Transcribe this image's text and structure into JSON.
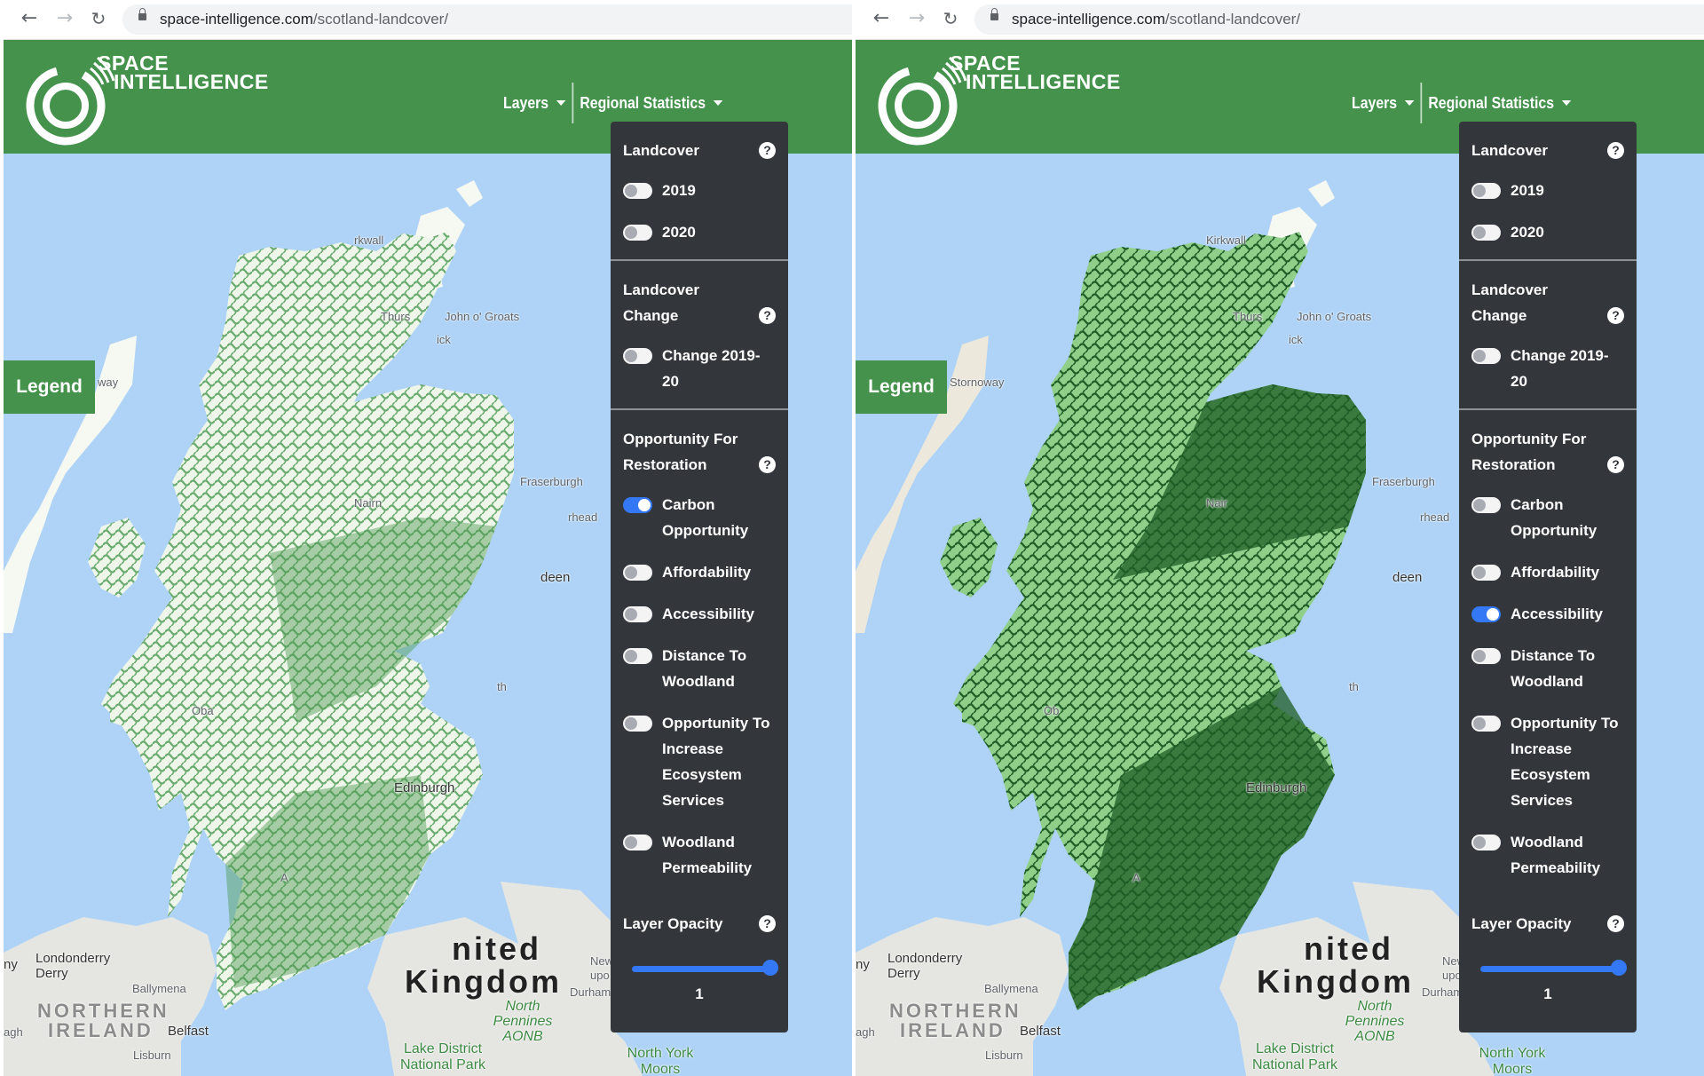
{
  "browser": {
    "url_host": "space-intelligence.com",
    "url_path": "/scotland-landcover/",
    "icons": {
      "back": "arrow-left-icon",
      "forward": "arrow-right-icon",
      "reload": "reload-icon",
      "lock": "lock-icon"
    }
  },
  "colors": {
    "header_green": "#44924c",
    "panel_bg": "#33363b",
    "toggle_on": "#3478f6",
    "sea": "#aed3f7",
    "layer_dark_green": "#1f5e26"
  },
  "panes": [
    {
      "brand": {
        "line1": "SPACE",
        "line2": "INTELLIGENCE"
      },
      "menu": {
        "layers": "Layers",
        "regional_statistics": "Regional Statistics"
      },
      "legend_label": "Legend",
      "sections": [
        {
          "title": "Landcover",
          "toggles": [
            {
              "label": "2019",
              "on": false
            },
            {
              "label": "2020",
              "on": false
            }
          ]
        },
        {
          "title": "Landcover Change",
          "toggles": [
            {
              "label": "Change 2019-20",
              "on": false
            }
          ]
        },
        {
          "title": "Opportunity For Restoration",
          "toggles": [
            {
              "label": "Carbon Opportunity",
              "on": true
            },
            {
              "label": "Affordability",
              "on": false
            },
            {
              "label": "Accessibility",
              "on": false
            },
            {
              "label": "Distance To Woodland",
              "on": false
            },
            {
              "label": "Opportunity To Increase Ecosystem Services",
              "on": false
            },
            {
              "label": "Woodland Permeability",
              "on": false
            }
          ]
        }
      ],
      "opacity": {
        "title": "Layer Opacity",
        "value": "1",
        "fraction": 1
      },
      "active_layer": "Carbon Opportunity",
      "map_labels": {
        "kirkwall": "rkwall",
        "thurso": "Thurs",
        "john_o_groats": "John o' Groats",
        "wick": "ick",
        "stornoway": "way",
        "fraserburgh": "Fraserburgh",
        "nairn": "Nairn",
        "peterhead": "rhead",
        "aberdeen": "deen",
        "montrose": "th",
        "oban": "Oba",
        "edinburgh": "Edinburgh",
        "united": "nited",
        "kingdom": "Kingdom",
        "londonderry": "Londonderry",
        "derry": "Derry",
        "ballymena": "Ballymena",
        "northern": "NORTHERN",
        "ireland": "IRELAND",
        "omagh": "agh",
        "belfast": "Belfast",
        "lisburn": "Lisburn",
        "newcastle": "New",
        "upon": "upo",
        "durham": "Durham",
        "north_pennines": "North Pennines AONB",
        "lake_district": "Lake District National Park",
        "north_york_moors": "North York Moors",
        "ayr": "A",
        "ny": "ny"
      }
    },
    {
      "brand": {
        "line1": "SPACE",
        "line2": "INTELLIGENCE"
      },
      "menu": {
        "layers": "Layers",
        "regional_statistics": "Regional Statistics"
      },
      "legend_label": "Legend",
      "sections": [
        {
          "title": "Landcover",
          "toggles": [
            {
              "label": "2019",
              "on": false
            },
            {
              "label": "2020",
              "on": false
            }
          ]
        },
        {
          "title": "Landcover Change",
          "toggles": [
            {
              "label": "Change 2019-20",
              "on": false
            }
          ]
        },
        {
          "title": "Opportunity For Restoration",
          "toggles": [
            {
              "label": "Carbon Opportunity",
              "on": false
            },
            {
              "label": "Affordability",
              "on": false
            },
            {
              "label": "Accessibility",
              "on": true
            },
            {
              "label": "Distance To Woodland",
              "on": false
            },
            {
              "label": "Opportunity To Increase Ecosystem Services",
              "on": false
            },
            {
              "label": "Woodland Permeability",
              "on": false
            }
          ]
        }
      ],
      "opacity": {
        "title": "Layer Opacity",
        "value": "1",
        "fraction": 1
      },
      "active_layer": "Accessibility",
      "map_labels": {
        "kirkwall": "Kirkwall",
        "thurso": "Thurs",
        "john_o_groats": "John o' Groats",
        "wick": "ick",
        "stornoway": "Stornoway",
        "fraserburgh": "Fraserburgh",
        "nairn": "Nair",
        "peterhead": "rhead",
        "aberdeen": "deen",
        "montrose": "th",
        "oban": "Ob",
        "edinburgh": "Edinburgh",
        "united": "nited",
        "kingdom": "Kingdom",
        "londonderry": "Londonderry",
        "derry": "Derry",
        "ballymena": "Ballymena",
        "northern": "NORTHERN",
        "ireland": "IRELAND",
        "omagh": "agh",
        "belfast": "Belfast",
        "lisburn": "Lisburn",
        "newcastle": "New",
        "upon": "upo",
        "durham": "Durham",
        "north_pennines": "North Pennines AONB",
        "lake_district": "Lake District National Park",
        "north_york_moors": "North York Moors",
        "ayr": "A",
        "ny": "ny"
      }
    }
  ]
}
